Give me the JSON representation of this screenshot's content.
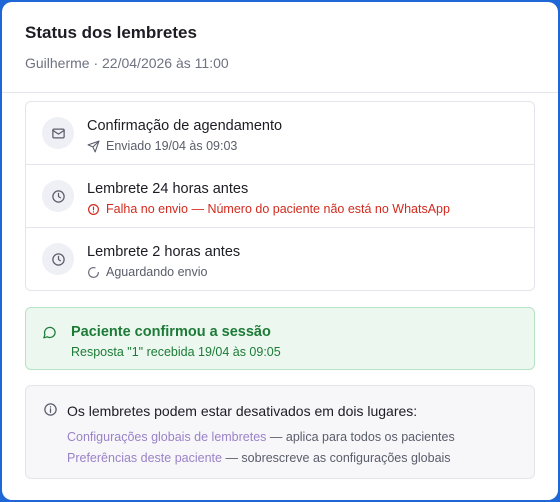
{
  "header": {
    "title": "Status dos lembretes",
    "subtitle": "Guilherme · 22/04/2026 às 11:00"
  },
  "reminders": [
    {
      "title": "Confirmação de agendamento",
      "status": "Enviado 19/04 às 09:03",
      "state": "sent",
      "icon": "mail-icon",
      "status_icon": "send-icon"
    },
    {
      "title": "Lembrete 24 horas antes",
      "status": "Falha no envio — Número do paciente não está no WhatsApp",
      "state": "error",
      "icon": "clock-icon",
      "status_icon": "alert-circle-icon"
    },
    {
      "title": "Lembrete 2 horas antes",
      "status": "Aguardando envio",
      "state": "pending",
      "icon": "clock-icon",
      "status_icon": "loader-icon"
    }
  ],
  "confirmation": {
    "title": "Paciente confirmou a sessão",
    "detail": "Resposta \"1\" recebida 19/04 às 09:05",
    "icon": "chat-bubble-icon"
  },
  "info": {
    "title": "Os lembretes podem estar desativados em dois lugares:",
    "icon": "info-icon",
    "lines": [
      {
        "link": "Configurações globais de lembretes",
        "text": " — aplica para todos os pacientes"
      },
      {
        "link": "Preferências deste paciente",
        "text": " — sobrescreve as configurações globais"
      }
    ]
  },
  "colors": {
    "frame": "#1f66d6",
    "error": "#d22a1e",
    "success": "#1d7a37",
    "success_bg": "#ecf8ef",
    "link": "#9a82c8"
  }
}
